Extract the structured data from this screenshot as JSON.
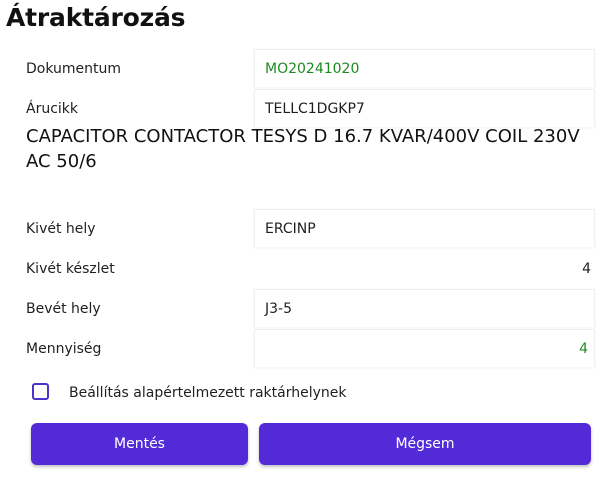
{
  "page": {
    "title": "Átraktározás"
  },
  "form": {
    "document": {
      "label": "Dokumentum",
      "value": "MO20241020"
    },
    "item_code": {
      "label": "Árucikk",
      "value": "TELLC1DGKP7"
    },
    "item_description": "CAPACITOR CONTACTOR TESYS D 16.7 KVAR/400V COIL 230V AC 50/6",
    "source_location": {
      "label": "Kivét hely",
      "value": "ERCINP"
    },
    "source_stock": {
      "label": "Kivét készlet",
      "value": "4"
    },
    "target_location": {
      "label": "Bevét hely",
      "value": "J3-5"
    },
    "quantity": {
      "label": "Mennyiség",
      "value": "4"
    },
    "default_location_checkbox": {
      "label": "Beállítás alapértelmezett raktárhelynek",
      "checked": false
    }
  },
  "buttons": {
    "save": "Mentés",
    "cancel": "Mégsem"
  },
  "colors": {
    "accent": "#532ad8",
    "value_green": "#1e8a1e"
  }
}
